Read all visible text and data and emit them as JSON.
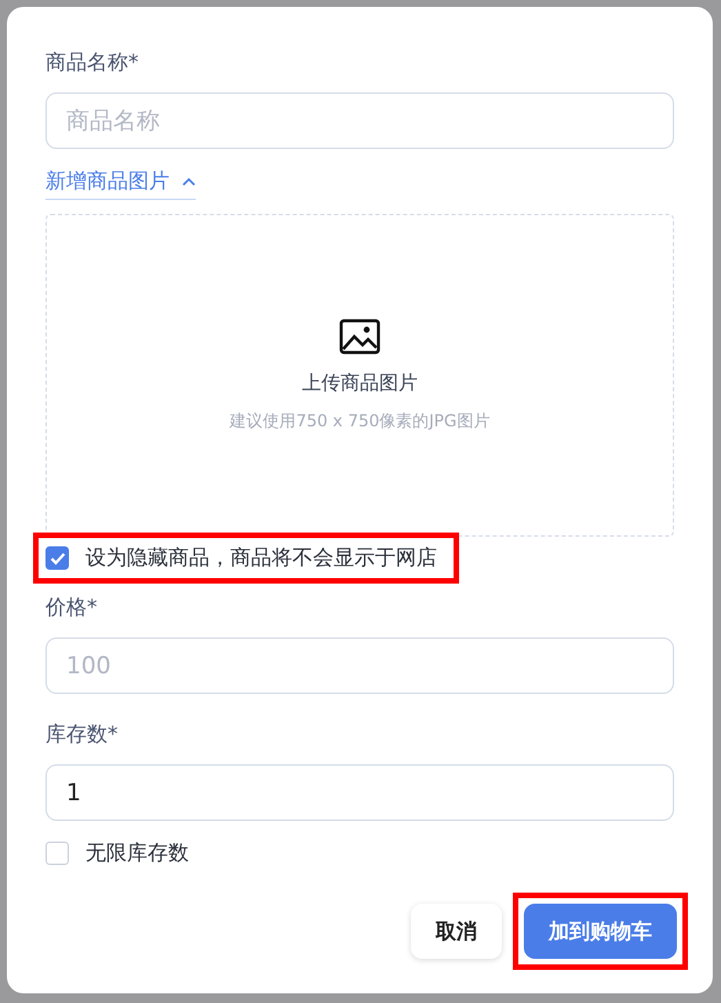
{
  "form": {
    "name_label": "商品名称*",
    "name_placeholder": "商品名称",
    "image_toggle": {
      "label": "新增商品图片",
      "expanded": true
    },
    "upload": {
      "title": "上传商品图片",
      "hint": "建议使用750 x 750像素的JPG图片"
    },
    "hidden_option": {
      "label": "设为隐藏商品，商品将不会显示于网店",
      "checked": true,
      "highlighted": true
    },
    "price_label": "价格*",
    "price_placeholder": "100",
    "stock_label": "库存数*",
    "stock_value": "1",
    "unlimited_option": {
      "label": "无限库存数",
      "checked": false,
      "highlighted": false
    }
  },
  "buttons": [
    {
      "label": "取消",
      "kind": "secondary",
      "highlighted": false
    },
    {
      "label": "加到购物车",
      "kind": "primary",
      "highlighted": true
    }
  ]
}
